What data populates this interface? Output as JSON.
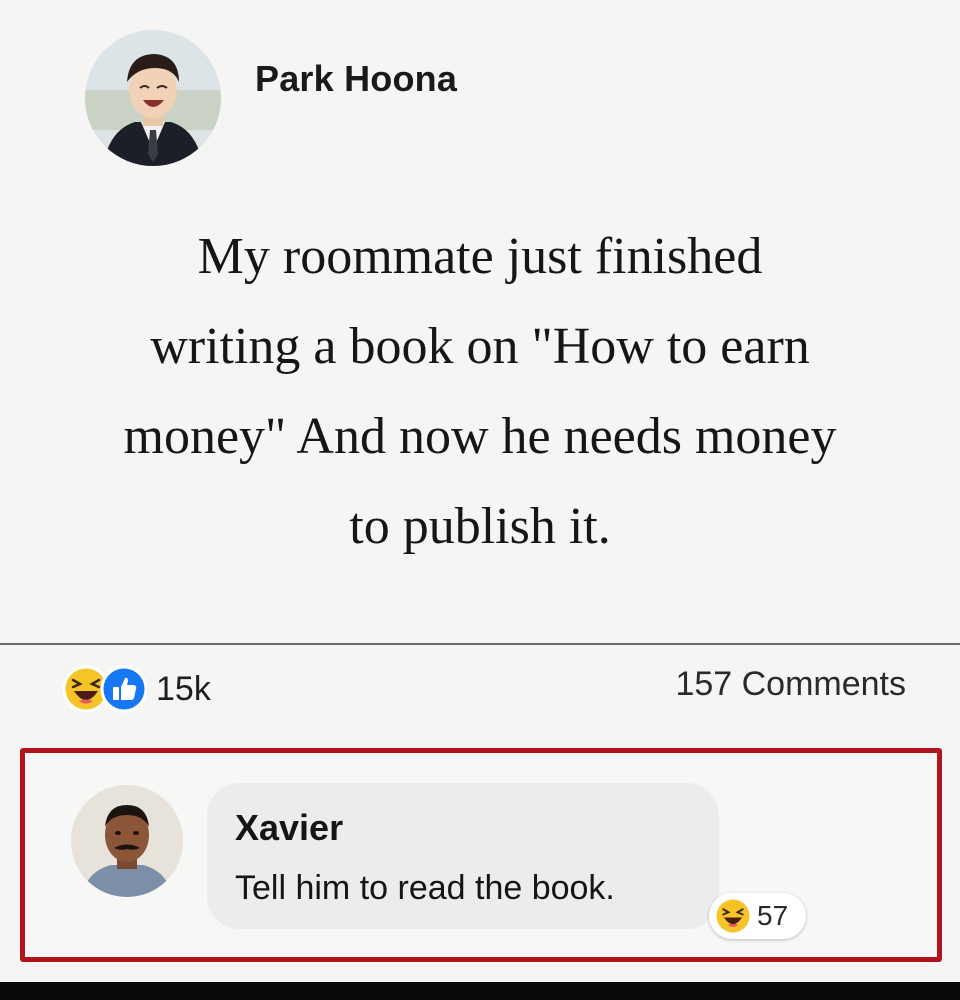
{
  "post": {
    "author": "Park Hoona",
    "text_lines": [
      "My roommate just finished",
      "writing a book on \"How to earn",
      "money\" And now he needs money",
      "to publish it."
    ]
  },
  "reactions": {
    "types": [
      "haha-emoji",
      "like-icon"
    ],
    "count": "15k",
    "comments_label": "157 Comments"
  },
  "comment": {
    "author": "Xavier",
    "text": "Tell him to read the book.",
    "reaction_type": "haha-emoji",
    "reaction_count": "57"
  },
  "colors": {
    "highlight_border": "#b0141c",
    "like_blue": "#1877f2",
    "haha_yellow": "#f7c427"
  }
}
